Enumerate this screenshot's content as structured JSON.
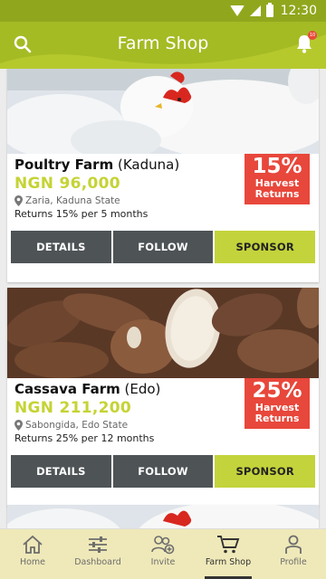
{
  "status_bar": {
    "time": "12:30"
  },
  "app_bar": {
    "title": "Farm Shop",
    "notification_count": "10"
  },
  "farms": [
    {
      "name": "Poultry Farm",
      "region": "(Kaduna)",
      "price": "NGN 96,000",
      "location": "Zaria, Kaduna State",
      "returns": "Returns 15% per 5 months",
      "badge_pct": "15%",
      "badge_line1": "Harvest",
      "badge_line2": "Returns",
      "details_label": "DETAILS",
      "follow_label": "FOLLOW",
      "sponsor_label": "SPONSOR"
    },
    {
      "name": "Cassava Farm",
      "region": "(Edo)",
      "price": "NGN 211,200",
      "location": "Sabongida, Edo State",
      "returns": "Returns 25% per 12 months",
      "badge_pct": "25%",
      "badge_line1": "Harvest",
      "badge_line2": "Returns",
      "details_label": "DETAILS",
      "follow_label": "FOLLOW",
      "sponsor_label": "SPONSOR"
    }
  ],
  "bottom_nav": [
    {
      "label": "Home",
      "icon": "home-icon"
    },
    {
      "label": "Dashboard",
      "icon": "sliders-icon"
    },
    {
      "label": "Invite",
      "icon": "invite-users-icon"
    },
    {
      "label": "Farm Shop",
      "icon": "cart-icon",
      "active": true
    },
    {
      "label": "Profile",
      "icon": "profile-icon"
    }
  ],
  "colors": {
    "status_bar": "#90a71d",
    "app_bar": "#b5c92d",
    "price_green": "#c5d335",
    "badge_red": "#e8473b",
    "button_dark": "#4e5356",
    "button_green": "#c3d33b",
    "bottom_nav": "#efe9b9"
  }
}
